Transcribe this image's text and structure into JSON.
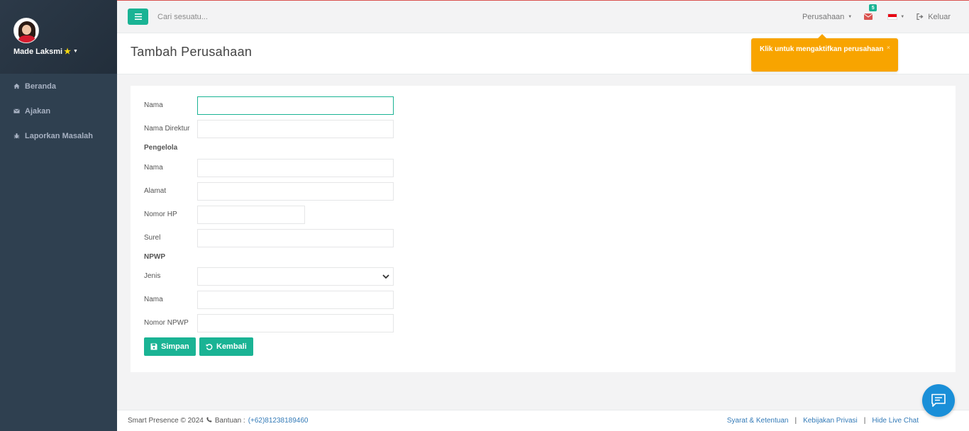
{
  "sidebar": {
    "user_name": "Made Laksmi",
    "items": [
      {
        "label": "Beranda",
        "icon": "home-icon"
      },
      {
        "label": "Ajakan",
        "icon": "envelope-icon"
      },
      {
        "label": "Laporkan Masalah",
        "icon": "bug-icon"
      }
    ]
  },
  "topbar": {
    "search_placeholder": "Cari sesuatu...",
    "company_menu": "Perusahaan",
    "mail_count": "5",
    "logout_label": "Keluar",
    "accent_color": "#1ab394"
  },
  "page": {
    "title": "Tambah Perusahaan"
  },
  "tooltip": {
    "text": "Klik untuk mengaktifkan perusahaan",
    "close": "×",
    "color": "#f8a400"
  },
  "form": {
    "nama_label": "Nama",
    "nama_direktur_label": "Nama Direktur",
    "pengelola_section": "Pengelola",
    "pengelola_nama_label": "Nama",
    "pengelola_alamat_label": "Alamat",
    "pengelola_hp_label": "Nomor HP",
    "pengelola_surel_label": "Surel",
    "npwp_section": "NPWP",
    "npwp_jenis_label": "Jenis",
    "npwp_nama_label": "Nama",
    "npwp_nomor_label": "Nomor NPWP",
    "save_label": "Simpan",
    "back_label": "Kembali"
  },
  "footer": {
    "copyright": "Smart Presence © 2024",
    "help_label": "Bantuan :",
    "help_phone": "(+62)81238189460",
    "links": [
      "Syarat & Ketentuan",
      "Kebijakan Privasi",
      "Hide Live Chat"
    ],
    "separator": "|"
  }
}
